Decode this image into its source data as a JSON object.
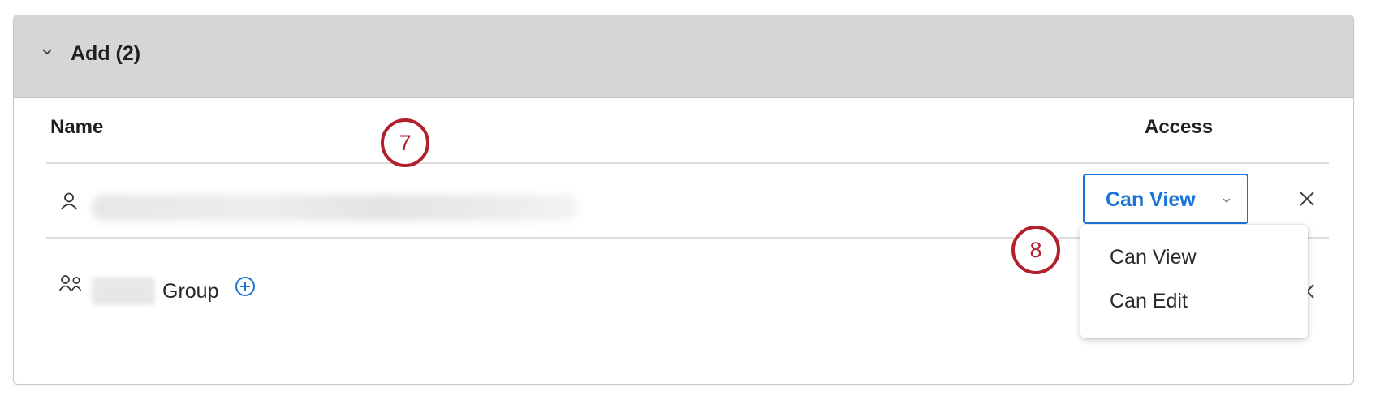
{
  "section": {
    "title": "Add (2)"
  },
  "table": {
    "columns": {
      "name": "Name",
      "access": "Access"
    },
    "rows": [
      {
        "type": "user",
        "name": "",
        "access": "Can View"
      },
      {
        "type": "group",
        "name": "",
        "suffix": "Group"
      }
    ]
  },
  "access_dropdown": {
    "options": [
      "Can View",
      "Can Edit"
    ]
  },
  "callouts": [
    "7",
    "8"
  ],
  "colors": {
    "header_bg": "#d6d6d6",
    "accent_blue": "#1a73d8",
    "callout_red": "#b21f2d"
  },
  "icons": {
    "section_toggle": "chevron-down-icon",
    "user": "user-icon",
    "group": "group-icon",
    "add": "plus-circle-icon",
    "remove": "close-icon"
  }
}
